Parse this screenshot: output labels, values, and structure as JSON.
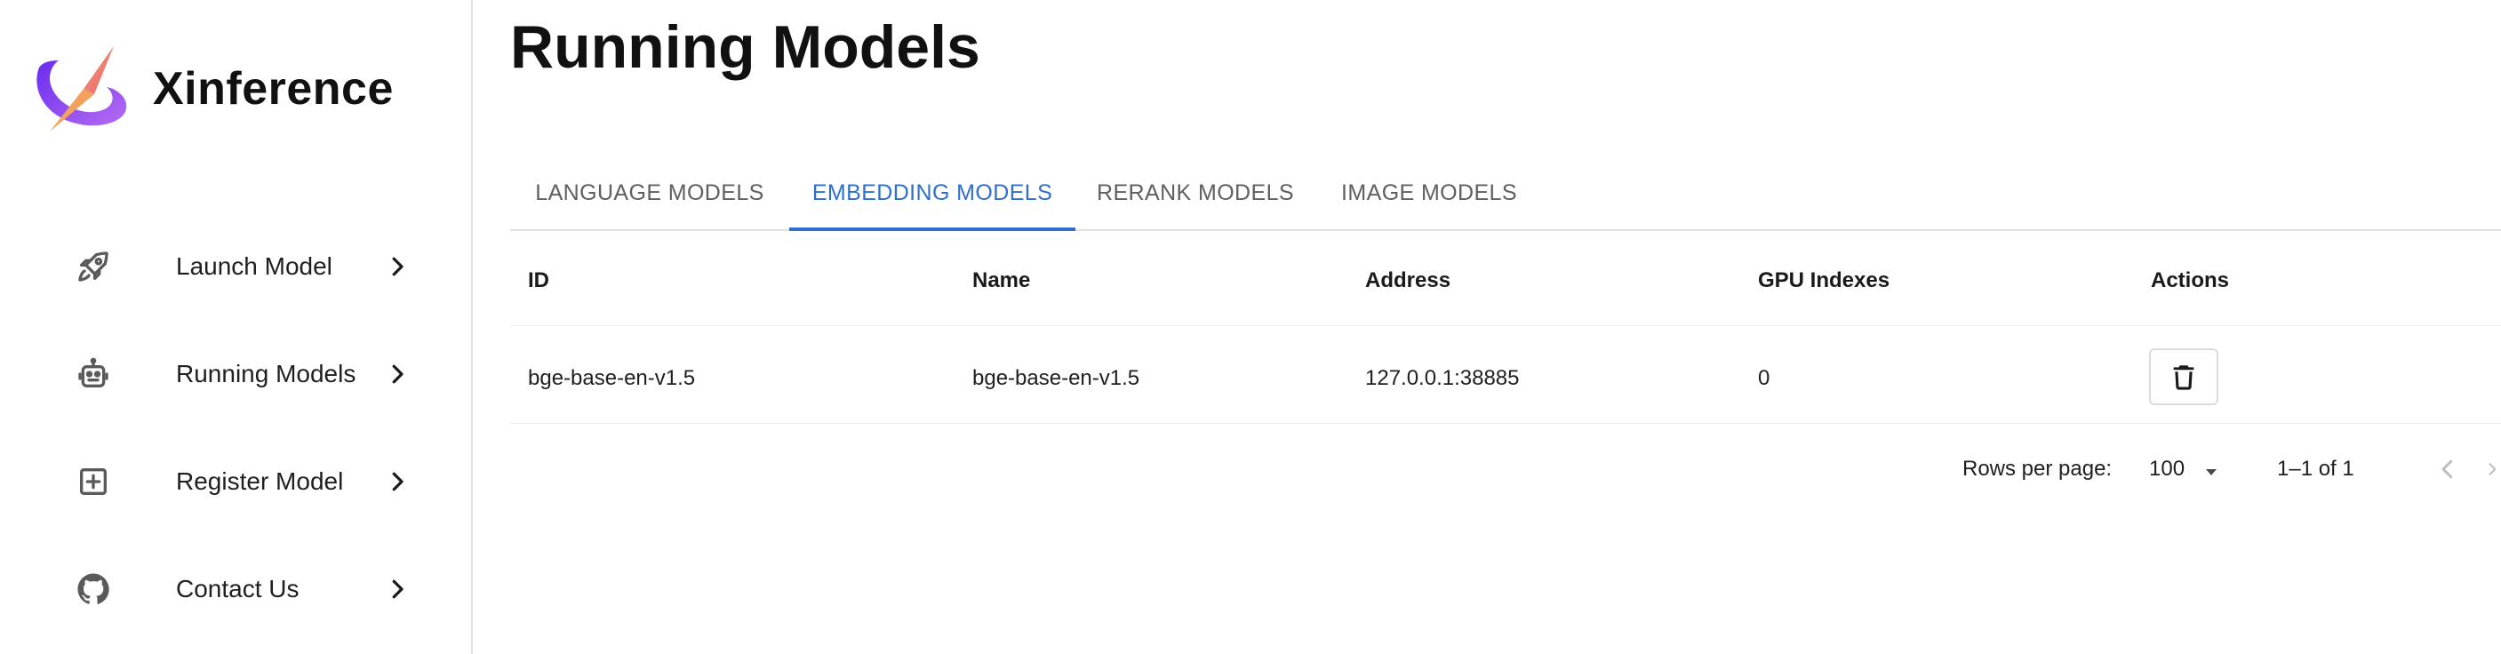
{
  "brand": {
    "name": "Xinference"
  },
  "sidebar": {
    "items": [
      {
        "label": "Launch Model",
        "icon": "rocket-icon"
      },
      {
        "label": "Running Models",
        "icon": "robot-icon"
      },
      {
        "label": "Register Model",
        "icon": "plus-box-icon"
      },
      {
        "label": "Contact Us",
        "icon": "github-icon"
      }
    ]
  },
  "main": {
    "title": "Running Models",
    "tabs": [
      {
        "label": "LANGUAGE MODELS",
        "active": false
      },
      {
        "label": "EMBEDDING MODELS",
        "active": true
      },
      {
        "label": "RERANK MODELS",
        "active": false
      },
      {
        "label": "IMAGE MODELS",
        "active": false
      }
    ],
    "table": {
      "headers": [
        "ID",
        "Name",
        "Address",
        "GPU Indexes",
        "Actions"
      ],
      "rows": [
        {
          "id": "bge-base-en-v1.5",
          "name": "bge-base-en-v1.5",
          "address": "127.0.0.1:38885",
          "gpu_indexes": "0"
        }
      ]
    },
    "pagination": {
      "rows_per_page_label": "Rows per page:",
      "rows_per_page_value": "100",
      "range": "1–1 of 1"
    }
  },
  "colors": {
    "accent": "#2f6fca",
    "text": "#1a1a1a",
    "muted": "#5f5f5f",
    "divider": "#e0e0e0"
  }
}
